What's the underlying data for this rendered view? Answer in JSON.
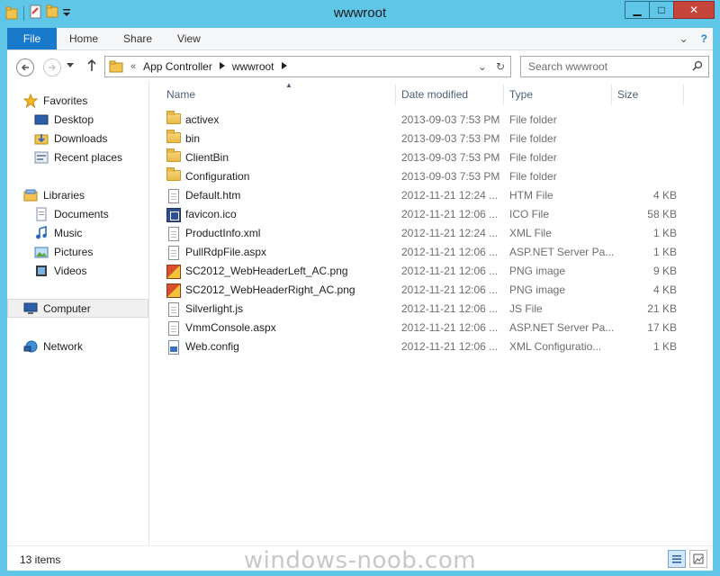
{
  "window": {
    "title": "wwwroot",
    "min_glyph": "▁",
    "max_glyph": "□",
    "close_glyph": "✕"
  },
  "ribbon": {
    "tabs": [
      "File",
      "Home",
      "Share",
      "View"
    ],
    "expand_glyph": "⌄",
    "help_glyph": "?"
  },
  "address": {
    "overflow": "«",
    "crumbs": [
      "App Controller",
      "wwwroot"
    ],
    "dropdown_glyph": "⌄",
    "refresh_glyph": "↻"
  },
  "search": {
    "placeholder": "Search wwwroot"
  },
  "nav": {
    "favorites": {
      "label": "Favorites",
      "items": [
        "Desktop",
        "Downloads",
        "Recent places"
      ]
    },
    "libraries": {
      "label": "Libraries",
      "items": [
        "Documents",
        "Music",
        "Pictures",
        "Videos"
      ]
    },
    "computer": "Computer",
    "network": "Network"
  },
  "columns": [
    "Name",
    "Date modified",
    "Type",
    "Size"
  ],
  "files": [
    {
      "name": "activex",
      "date": "2013-09-03 7:53 PM",
      "type": "File folder",
      "size": "",
      "icon": "folder-icon"
    },
    {
      "name": "bin",
      "date": "2013-09-03 7:53 PM",
      "type": "File folder",
      "size": "",
      "icon": "folder-icon"
    },
    {
      "name": "ClientBin",
      "date": "2013-09-03 7:53 PM",
      "type": "File folder",
      "size": "",
      "icon": "folder-icon"
    },
    {
      "name": "Configuration",
      "date": "2013-09-03 7:53 PM",
      "type": "File folder",
      "size": "",
      "icon": "folder-icon"
    },
    {
      "name": "Default.htm",
      "date": "2012-11-21 12:24 ...",
      "type": "HTM File",
      "size": "4 KB",
      "icon": "document-icon"
    },
    {
      "name": "favicon.ico",
      "date": "2012-11-21 12:06 ...",
      "type": "ICO File",
      "size": "58 KB",
      "icon": "ico-file-icon"
    },
    {
      "name": "ProductInfo.xml",
      "date": "2012-11-21 12:24 ...",
      "type": "XML File",
      "size": "1 KB",
      "icon": "document-icon"
    },
    {
      "name": "PullRdpFile.aspx",
      "date": "2012-11-21 12:06 ...",
      "type": "ASP.NET Server Pa...",
      "size": "1 KB",
      "icon": "document-icon"
    },
    {
      "name": "SC2012_WebHeaderLeft_AC.png",
      "date": "2012-11-21 12:06 ...",
      "type": "PNG image",
      "size": "9 KB",
      "icon": "png-image-icon"
    },
    {
      "name": "SC2012_WebHeaderRight_AC.png",
      "date": "2012-11-21 12:06 ...",
      "type": "PNG image",
      "size": "4 KB",
      "icon": "png-image-icon"
    },
    {
      "name": "Silverlight.js",
      "date": "2012-11-21 12:06 ...",
      "type": "JS File",
      "size": "21 KB",
      "icon": "document-icon"
    },
    {
      "name": "VmmConsole.aspx",
      "date": "2012-11-21 12:06 ...",
      "type": "ASP.NET Server Pa...",
      "size": "17 KB",
      "icon": "document-icon"
    },
    {
      "name": "Web.config",
      "date": "2012-11-21 12:06 ...",
      "type": "XML Configuratio...",
      "size": "1 KB",
      "icon": "config-file-icon"
    }
  ],
  "status": {
    "count": "13 items"
  },
  "watermark": "windows-noob.com",
  "colors": {
    "frame": "#5fc6e8",
    "file_tab": "#1979ca",
    "close": "#c7443a"
  }
}
